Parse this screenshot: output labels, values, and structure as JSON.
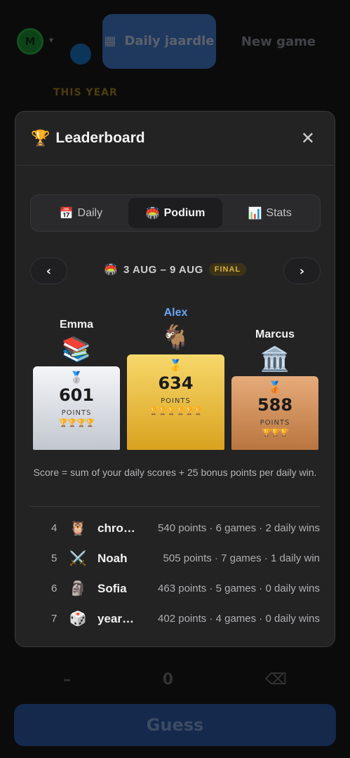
{
  "background": {
    "avatar_letter": "M",
    "daily_button": "Daily jaardle",
    "new_game_button": "New game",
    "this_year_label": "THIS YEAR",
    "bottom_row": [
      "–",
      "0",
      "⌫"
    ],
    "guess_button": "Guess"
  },
  "modal": {
    "title_icon": "🏆",
    "title": "Leaderboard",
    "close": "✕",
    "tabs": [
      {
        "icon": "📅",
        "label": "Daily",
        "active": false
      },
      {
        "icon": "🏟️",
        "label": "Podium",
        "active": true
      },
      {
        "icon": "📊",
        "label": "Stats",
        "active": false
      }
    ],
    "week": {
      "prev": "‹",
      "next": "›",
      "icon": "🏟️",
      "range": "3 AUG – 9 AUG",
      "badge": "FINAL"
    },
    "podium": {
      "second": {
        "name": "Emma",
        "avatar": "📚",
        "medal": "🥈",
        "points": "601",
        "points_label": "POINTS",
        "cups": "🏆🏆🏆🏆"
      },
      "first": {
        "name": "Alex",
        "avatar": "🐐",
        "medal": "🥇",
        "points": "634",
        "points_label": "POINTS",
        "cups": "🏆🏆🏆🏆🏆🏆"
      },
      "third": {
        "name": "Marcus",
        "avatar": "🏛️",
        "medal": "🥉",
        "points": "588",
        "points_label": "POINTS",
        "cups": "🏆🏆🏆"
      }
    },
    "score_note": "Score = sum of your daily scores + 25 bonus points per daily win.",
    "ranking": [
      {
        "rank": "4",
        "emoji": "🦉",
        "name": "chro…",
        "stats": "540 points · 6 games · 2 daily wins"
      },
      {
        "rank": "5",
        "emoji": "⚔️",
        "name": "Noah",
        "stats": "505 points · 7 games · 1 daily win"
      },
      {
        "rank": "6",
        "emoji": "🗿",
        "name": "Sofia",
        "stats": "463 points · 5 games · 0 daily wins"
      },
      {
        "rank": "7",
        "emoji": "🎲",
        "name": "year…",
        "stats": "402 points · 4 games · 0 daily wins"
      }
    ]
  }
}
